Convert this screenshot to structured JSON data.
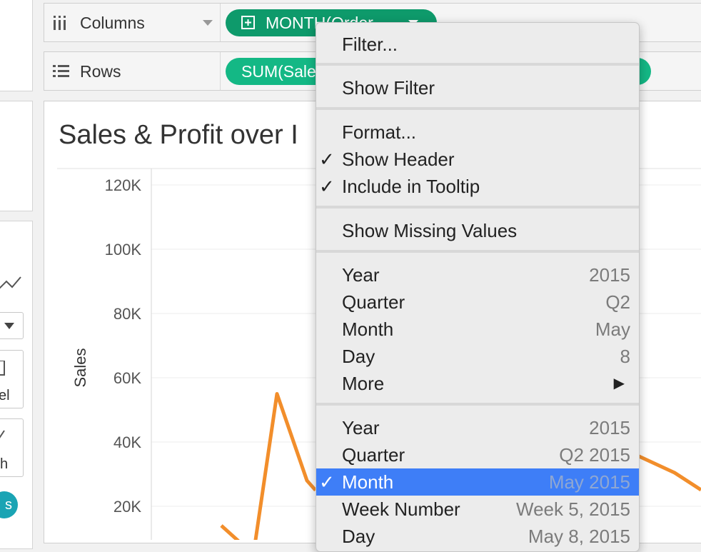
{
  "shelves": {
    "columns": {
      "label": "Columns",
      "pill": "MONTH(Order..."
    },
    "rows": {
      "label": "Rows",
      "pill": "SUM(Sale"
    }
  },
  "left_panel": {
    "partial_label_1": "el",
    "partial_label_2": "h",
    "partial_pill": "s"
  },
  "viz": {
    "title": "Sales & Profit over I"
  },
  "chart_data": {
    "type": "line",
    "ylabel": "Sales",
    "yticks": [
      "120K",
      "100K",
      "80K",
      "60K",
      "40K",
      "20K"
    ],
    "ylim": [
      0,
      120000
    ],
    "series": [
      {
        "values": [
          14000,
          5000,
          55000,
          28000,
          25000
        ]
      }
    ],
    "series_color": "#f28e2b"
  },
  "menu": {
    "filter": "Filter...",
    "show_filter": "Show Filter",
    "format": "Format...",
    "show_header": "Show Header",
    "include_tooltip": "Include in Tooltip",
    "show_missing": "Show Missing Values",
    "discrete": [
      {
        "label": "Year",
        "value": "2015"
      },
      {
        "label": "Quarter",
        "value": "Q2"
      },
      {
        "label": "Month",
        "value": "May"
      },
      {
        "label": "Day",
        "value": "8"
      },
      {
        "label": "More",
        "value": ""
      }
    ],
    "continuous": [
      {
        "label": "Year",
        "value": "2015"
      },
      {
        "label": "Quarter",
        "value": "Q2 2015"
      },
      {
        "label": "Month",
        "value": "May 2015"
      },
      {
        "label": "Week Number",
        "value": "Week 5, 2015"
      },
      {
        "label": "Day",
        "value": "May 8, 2015"
      }
    ],
    "checkmark": "✓",
    "submenu_arrow": "▶"
  },
  "icons": {
    "columns_icon": "columns-bars-icon",
    "rows_icon": "rows-list-icon",
    "dropdown": "caret-down-icon",
    "plus_box": "plus-box-icon"
  }
}
